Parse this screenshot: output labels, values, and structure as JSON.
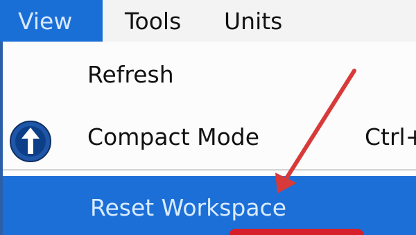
{
  "menubar": {
    "items": [
      {
        "label": "View"
      },
      {
        "label": "Tools"
      },
      {
        "label": "Units"
      }
    ]
  },
  "dropdown": {
    "refresh_label": "Refresh",
    "compact_label": "Compact Mode",
    "compact_shortcut": "Ctrl+",
    "reset_label": "Reset Workspace"
  },
  "colors": {
    "menu_highlight": "#1a6fd6",
    "arrow": "#d83a3a",
    "icon_fill": "#1f56a8"
  },
  "icons": {
    "compact_mode": "up-arrow-circle-icon",
    "annotation": "red-arrow-icon"
  }
}
